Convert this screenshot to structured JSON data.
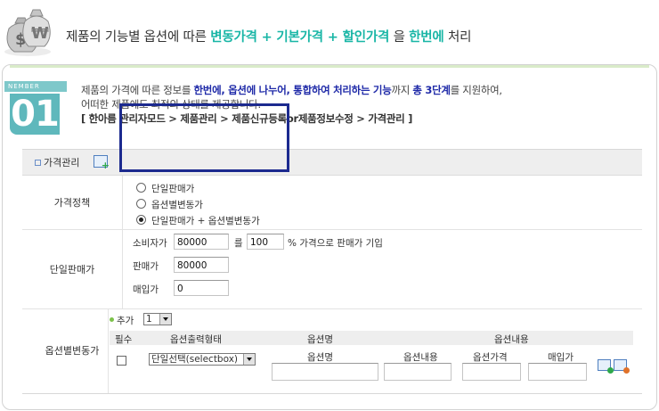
{
  "header": {
    "icon": "money-bags-icon",
    "segments": [
      {
        "text": "제품의 기능별 옵션에 따른 ",
        "hl": false
      },
      {
        "text": "변동가격 + 기본가격 + 할인가격",
        "hl": true
      },
      {
        "text": " 을 ",
        "hl": false
      },
      {
        "text": "한번에",
        "hl": true
      },
      {
        "text": " 처리",
        "hl": false
      }
    ],
    "accent_color": "#19b6a6"
  },
  "badge": {
    "label": "NEMBER",
    "number": "01"
  },
  "intro": {
    "line1_a": "제품의 가격에 따른 정보를 ",
    "line1_b": "한번에, 옵션에 나누어, 통합하여 처리하는 기능",
    "line1_c": "까지 ",
    "line1_d": "총 3단계",
    "line1_e": "를 지원하여,",
    "line2": "어떠한 제품에도 최적의 상태를 제공합니다.",
    "line3": "[ 한아름 관리자모드 > 제품관리 > 제품신규등록or제품정보수정 > 가격관리 ]"
  },
  "form": {
    "title": "가격관리",
    "policy": {
      "label": "가격정책",
      "options": [
        "단일판매가",
        "옵션별변동가",
        "단일판매가 + 옵션별변동가"
      ],
      "selected": 2
    },
    "single": {
      "label": "단일판매가",
      "consumer_label": "소비자가",
      "consumer_value": "80000",
      "rate_prefix": "를",
      "rate_value": "100",
      "rate_suffix": "% 가격으로 판매가 기입",
      "sale_label": "판매가",
      "sale_value": "80000",
      "purchase_label": "매입가",
      "purchase_value": "0"
    },
    "option": {
      "label": "옵션별변동가",
      "add_label": "추가",
      "add_count": "1",
      "col_required": "필수",
      "col_type": "옵션출력형태",
      "col_name": "옵션명",
      "col_content": "옵션내용",
      "sub_name": "옵션명",
      "sub_content": "옵션내용",
      "sub_price": "옵션가격",
      "sub_purchase": "매입가",
      "type_value": "단일선택(selectbox)"
    }
  }
}
